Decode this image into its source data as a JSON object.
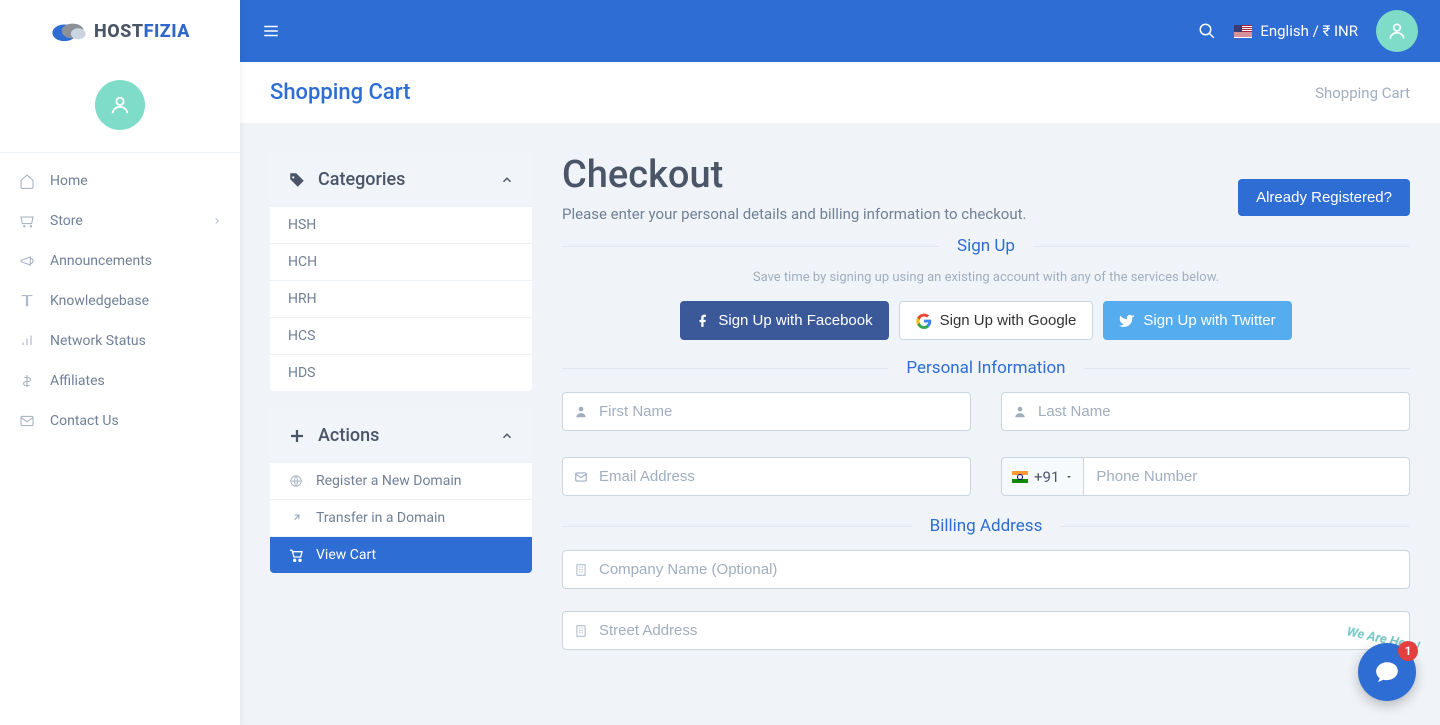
{
  "brand": {
    "name_part1": "HOST",
    "name_part2": "FIZIA"
  },
  "topbar": {
    "locale_text": "English / ₹ INR"
  },
  "page": {
    "title": "Shopping Cart",
    "breadcrumb": "Shopping Cart"
  },
  "sidebar_nav": [
    {
      "label": "Home"
    },
    {
      "label": "Store"
    },
    {
      "label": "Announcements"
    },
    {
      "label": "Knowledgebase"
    },
    {
      "label": "Network Status"
    },
    {
      "label": "Affiliates"
    },
    {
      "label": "Contact Us"
    }
  ],
  "categories": {
    "title": "Categories",
    "items": [
      "HSH",
      "HCH",
      "HRH",
      "HCS",
      "HDS"
    ]
  },
  "actions": {
    "title": "Actions",
    "items": [
      {
        "label": "Register a New Domain"
      },
      {
        "label": "Transfer in a Domain"
      },
      {
        "label": "View Cart",
        "active": true
      }
    ]
  },
  "checkout": {
    "heading": "Checkout",
    "subtext": "Please enter your personal details and billing information to checkout.",
    "already_btn": "Already Registered?",
    "signup_title": "Sign Up",
    "signup_hint": "Save time by signing up using an existing account with any of the services below.",
    "fb_label": "Sign Up with Facebook",
    "google_label": "Sign Up with Google",
    "twitter_label": "Sign Up with Twitter",
    "personal_title": "Personal Information",
    "billing_title": "Billing Address",
    "placeholders": {
      "first_name": "First Name",
      "last_name": "Last Name",
      "email": "Email Address",
      "phone": "Phone Number",
      "company": "Company Name (Optional)",
      "street": "Street Address"
    },
    "country_code": "+91"
  },
  "chat": {
    "here_text": "We Are Here!",
    "badge": "1"
  }
}
